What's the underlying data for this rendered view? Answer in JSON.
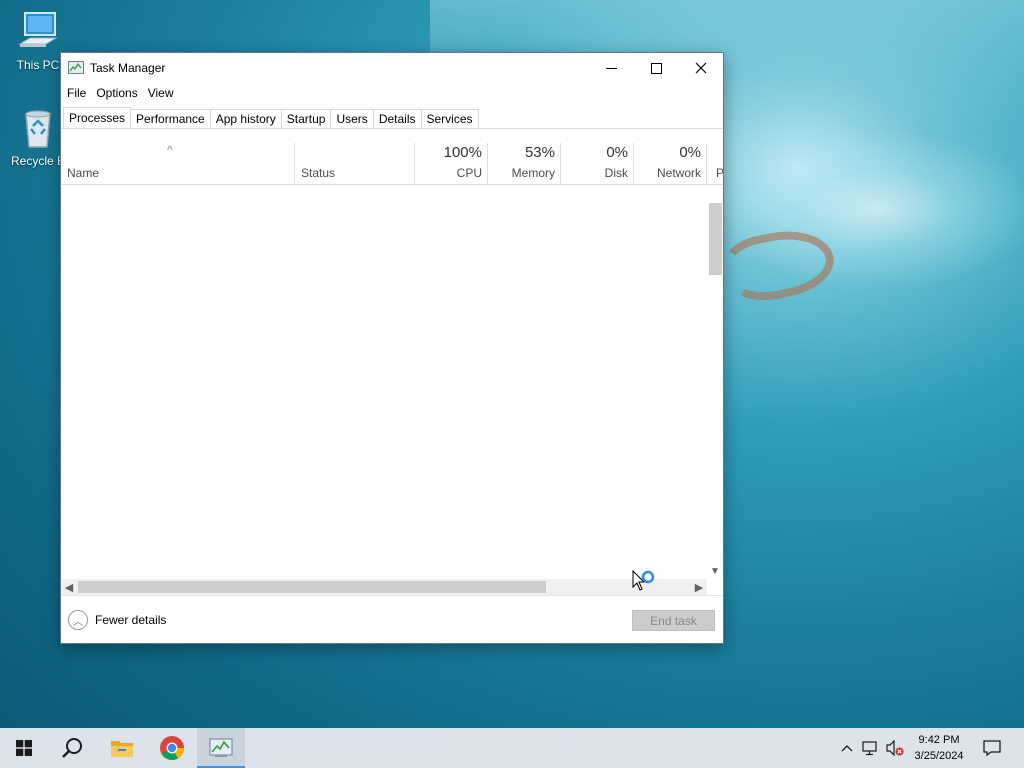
{
  "desktop": {
    "icons": [
      {
        "label": "This PC",
        "icon": "computer-icon"
      },
      {
        "label": "Recycle B",
        "icon": "recycle-bin-icon"
      }
    ]
  },
  "window": {
    "title": "Task Manager",
    "app_icon": "task-manager-icon",
    "controls": {
      "minimize": "minimize-icon",
      "maximize": "maximize-icon",
      "close": "close-icon"
    },
    "menu": [
      "File",
      "Options",
      "View"
    ],
    "tabs": [
      "Processes",
      "Performance",
      "App history",
      "Startup",
      "Users",
      "Details",
      "Services"
    ],
    "active_tab": "Processes",
    "columns": {
      "name": {
        "label": "Name"
      },
      "status": {
        "label": "Status"
      },
      "cpu": {
        "label": "CPU",
        "value": "100%"
      },
      "memory": {
        "label": "Memory",
        "value": "53%"
      },
      "disk": {
        "label": "Disk",
        "value": "0%"
      },
      "network": {
        "label": "Network",
        "value": "0%"
      },
      "power": {
        "label": "P"
      }
    },
    "sort_indicator": "^",
    "rows": [],
    "footer": {
      "fewer_details": "Fewer details",
      "end_task": "End task"
    }
  },
  "taskbar": {
    "apps": [
      "start-icon",
      "search-icon",
      "file-explorer-icon",
      "chrome-icon",
      "task-manager-icon"
    ],
    "tray": [
      "chevron-up-icon",
      "network-icon",
      "volume-muted-icon",
      "notification-icon"
    ],
    "time": "9:42 PM",
    "date": "3/25/2024"
  },
  "colors": {
    "accent": "#4a90d9",
    "taskbar": "#dde3ea",
    "end_task_disabled": "#cccccc"
  }
}
